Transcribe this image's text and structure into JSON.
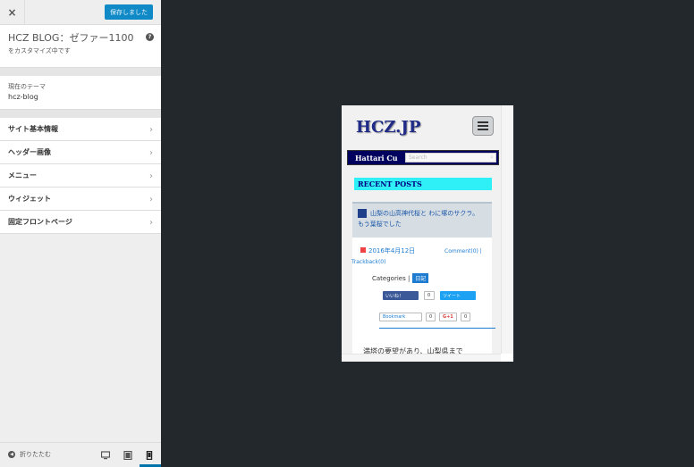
{
  "header": {
    "close_label": "×",
    "save_label": "保存しました"
  },
  "info": {
    "title": "HCZ BLOG：ゼファー1100",
    "subtitle": "をカスタマイズ中です",
    "help_label": "?"
  },
  "theme": {
    "label": "現在のテーマ",
    "name": "hcz-blog"
  },
  "sections": [
    {
      "label": "サイト基本情報"
    },
    {
      "label": "ヘッダー画像"
    },
    {
      "label": "メニュー"
    },
    {
      "label": "ウィジェット"
    },
    {
      "label": "固定フロントページ"
    }
  ],
  "footer": {
    "collapse_label": "折りたたむ"
  },
  "preview": {
    "site_title": "HCZ.JP",
    "nav_text": "Hattari Cu",
    "search_placeholder": "Search",
    "recent_posts_label": "RECENT POSTS",
    "post_title": "山梨の山高神代桜と わに塚のサクラ。　もう葉桜でした",
    "post_date": "2016年4月12日",
    "comment": "Comment(0) |",
    "trackback": "Trackback(0)",
    "categories_label": "Categories |",
    "category_tag": "日記",
    "fb_label": "いいね！",
    "fb_count": "0",
    "tweet_label": "ツイート",
    "bookmark_label": "Bookmark",
    "bookmark_count": "0",
    "gplus_label": "G+1",
    "gplus_count": "0",
    "excerpt": "満塔の要望があり、山梨県まで"
  },
  "colors": {
    "accent": "#0f8ac7",
    "nav_bg": "#00005e",
    "recent_bg": "#2ef0f6",
    "link": "#1e7cd0"
  }
}
